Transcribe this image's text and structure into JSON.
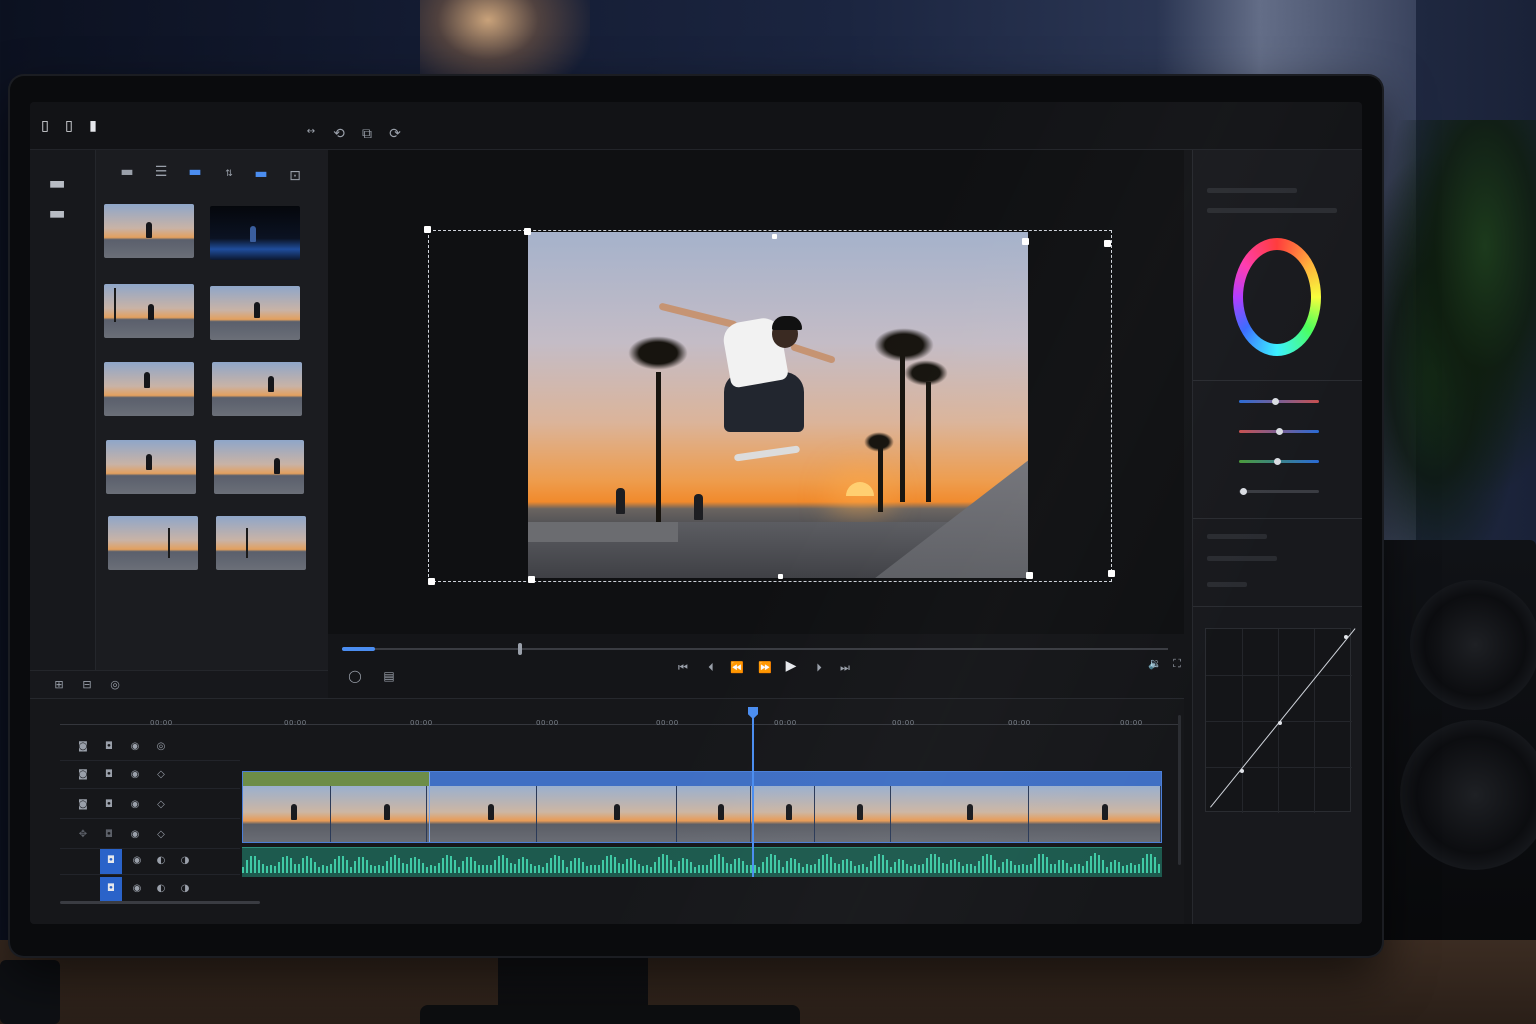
{
  "app": {
    "accent_color": "#4b8df0",
    "audio_color": "#3fcaa5"
  },
  "topbar": {
    "icons": [
      "panel-icon",
      "page-icon",
      "page-narrow-icon",
      "arrow-icon",
      "rotate-icon",
      "crop-icon",
      "loop-icon"
    ]
  },
  "media": {
    "folders": [
      "folder-icon",
      "folder-icon"
    ],
    "toolbar_icons": [
      "folder-icon",
      "list-icon",
      "folder-blue-icon",
      "sort-icon",
      "folder-open-icon",
      "import-icon"
    ],
    "thumbnail_count": 10
  },
  "transport": {
    "progress": 0.04,
    "buttons": [
      "go-to-start-icon",
      "previous-frame-icon",
      "step-back-icon",
      "step-forward-icon",
      "play-icon",
      "next-frame-icon",
      "go-to-end-icon"
    ]
  },
  "timeline": {
    "ruler_labels": [
      "00:00",
      "00:00",
      "00:00",
      "00:00",
      "00:00",
      "00:00",
      "00:00",
      "00:00",
      "00:00",
      "00:00"
    ],
    "playhead_position": 0.62
  },
  "color": {
    "sliders": [
      {
        "value": 0.45
      },
      {
        "value": 0.5
      },
      {
        "value": 0.48
      },
      {
        "value": 0.05
      }
    ]
  }
}
